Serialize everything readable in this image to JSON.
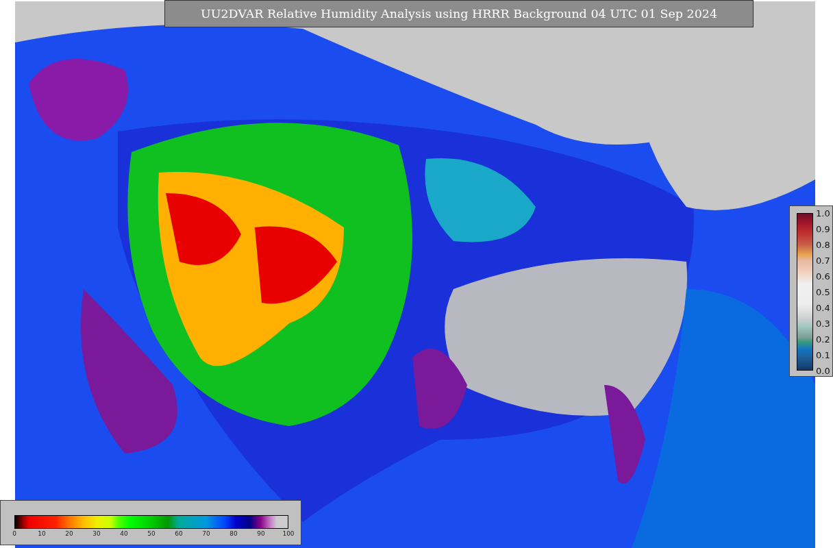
{
  "title": "UU2DVAR Relative Humidity Analysis using HRRR Background 04 UTC 01 Sep 2024",
  "humidity_colorbar": {
    "ticks": [
      "0",
      "10",
      "20",
      "30",
      "40",
      "50",
      "60",
      "70",
      "80",
      "90",
      "100"
    ]
  },
  "increment_colorbar": {
    "ticks": [
      "1.0",
      "0.9",
      "0.8",
      "0.7",
      "0.6",
      "0.5",
      "0.4",
      "0.3",
      "0.2",
      "0.1",
      "0.0"
    ]
  }
}
